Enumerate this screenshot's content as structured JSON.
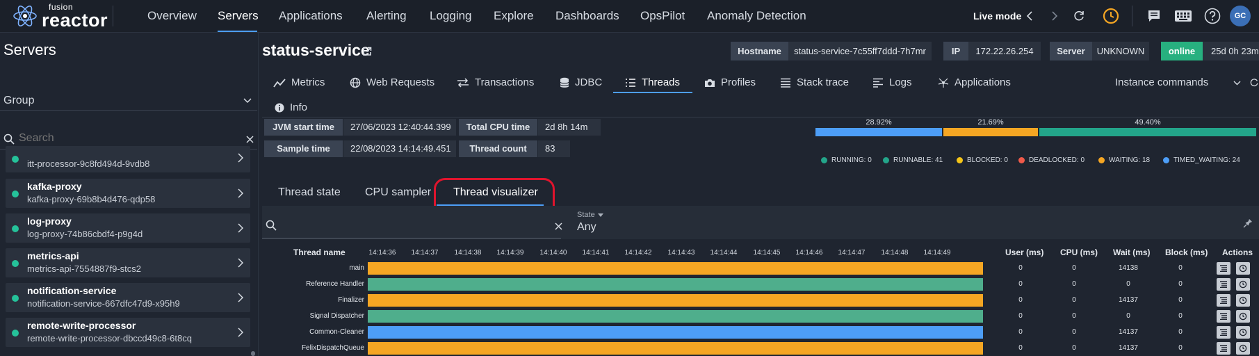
{
  "brand": {
    "line1": "fusion",
    "line2": "reactor",
    "tm": "™"
  },
  "nav": {
    "items": [
      "Overview",
      "Servers",
      "Applications",
      "Alerting",
      "Logging",
      "Explore",
      "Dashboards",
      "OpsPilot",
      "Anomaly Detection"
    ],
    "active": "Servers",
    "live_mode": "Live mode",
    "avatar": "GC"
  },
  "sidebar": {
    "title": "Servers",
    "group_label": "Group",
    "search_placeholder": "Search",
    "servers": [
      {
        "name": "",
        "host": "itt-processor-9c8fd494d-9vdb8"
      },
      {
        "name": "kafka-proxy",
        "host": "kafka-proxy-69b8b4d476-qdp58"
      },
      {
        "name": "log-proxy",
        "host": "log-proxy-74b86cbdf4-p9g4d"
      },
      {
        "name": "metrics-api",
        "host": "metrics-api-7554887f9-stcs2"
      },
      {
        "name": "notification-service",
        "host": "notification-service-667dfc47d9-x95h9"
      },
      {
        "name": "remote-write-processor",
        "host": "remote-write-processor-dbccd49c8-6t8cq"
      }
    ]
  },
  "header": {
    "service": "status-service",
    "hostname_label": "Hostname",
    "hostname_value": "status-service-7c55ff7ddd-7h7mr",
    "ip_label": "IP",
    "ip_value": "172.22.26.254",
    "server_label": "Server",
    "server_value": "UNKNOWN",
    "status": "online",
    "uptime": "25d 0h 23m"
  },
  "tabs": {
    "items": [
      "Metrics",
      "Web Requests",
      "Transactions",
      "JDBC",
      "Threads",
      "Profiles",
      "Stack trace",
      "Logs",
      "Applications",
      "Info"
    ],
    "active": "Threads",
    "instance_commands": "Instance commands"
  },
  "summary": {
    "jvm_start_label": "JVM start time",
    "jvm_start_value": "27/06/2023 12:40:44.399",
    "cpu_label": "Total CPU time",
    "cpu_value": "2d 8h 14m",
    "sample_label": "Sample time",
    "sample_value": "22/08/2023 14:14:49.451",
    "count_label": "Thread count",
    "count_value": "83"
  },
  "distribution": {
    "segments": [
      {
        "pct_label": "28.92%",
        "fraction": 0.2892,
        "color": "#4d9ef7"
      },
      {
        "pct_label": "21.69%",
        "fraction": 0.2169,
        "color": "#f5a623"
      },
      {
        "pct_label": "49.40%",
        "fraction": 0.494,
        "color": "#23a58a"
      }
    ],
    "legend": [
      {
        "label": "RUNNING: 0",
        "color": "#23a58a"
      },
      {
        "label": "RUNNABLE: 41",
        "color": "#23a58a"
      },
      {
        "label": "BLOCKED: 0",
        "color": "#f5c518"
      },
      {
        "label": "DEADLOCKED: 0",
        "color": "#f05a4a"
      },
      {
        "label": "WAITING: 18",
        "color": "#f5a623"
      },
      {
        "label": "TIMED_WAITING: 24",
        "color": "#4d9ef7"
      }
    ]
  },
  "subtabs": {
    "items": [
      "Thread state",
      "CPU sampler",
      "Thread visualizer"
    ],
    "active": "Thread visualizer"
  },
  "filter": {
    "search_value": "",
    "state_label": "State",
    "state_value": "Any"
  },
  "table": {
    "headers": {
      "name": "Thread name",
      "user": "User (ms)",
      "cpu": "CPU (ms)",
      "wait": "Wait (ms)",
      "block": "Block (ms)",
      "actions": "Actions"
    },
    "times": [
      "14:14:36",
      "14:14:37",
      "14:14:38",
      "14:14:39",
      "14:14:40",
      "14:14:41",
      "14:14:42",
      "14:14:43",
      "14:14:44",
      "14:14:45",
      "14:14:46",
      "14:14:47",
      "14:14:48",
      "14:14:49"
    ],
    "rows": [
      {
        "name": "main",
        "user": "0",
        "cpu": "0",
        "wait": "14138",
        "block": "0",
        "color": "#f5a623"
      },
      {
        "name": "Reference Handler",
        "user": "0",
        "cpu": "0",
        "wait": "0",
        "block": "0",
        "color": "#4fae8c"
      },
      {
        "name": "Finalizer",
        "user": "0",
        "cpu": "0",
        "wait": "14137",
        "block": "0",
        "color": "#f5a623"
      },
      {
        "name": "Signal Dispatcher",
        "user": "0",
        "cpu": "0",
        "wait": "0",
        "block": "0",
        "color": "#4fae8c"
      },
      {
        "name": "Common-Cleaner",
        "user": "0",
        "cpu": "0",
        "wait": "14137",
        "block": "0",
        "color": "#4d9ef7"
      },
      {
        "name": "FelixDispatchQueue",
        "user": "0",
        "cpu": "0",
        "wait": "14137",
        "block": "0",
        "color": "#f5a623"
      }
    ]
  }
}
